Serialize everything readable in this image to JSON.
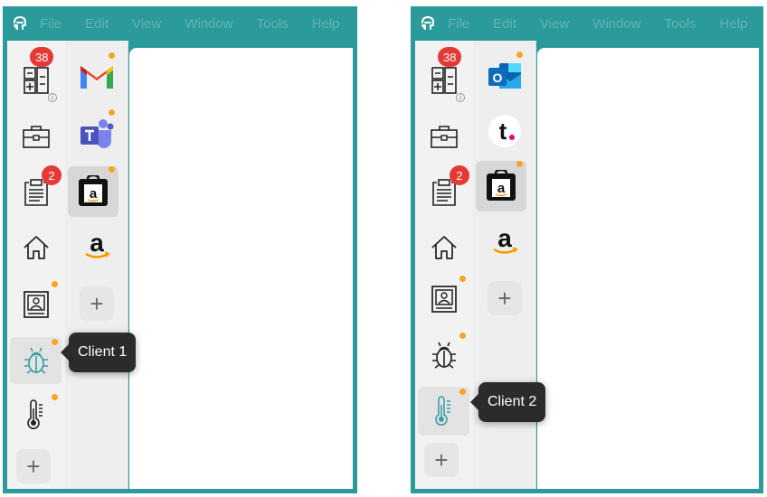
{
  "menu": [
    "File",
    "Edit",
    "View",
    "Window",
    "Tools",
    "Help"
  ],
  "colors": {
    "frame": "#2a9a9a",
    "badge": "#e53935",
    "dot": "#f5a623",
    "active_icon": "#3a9ea5"
  },
  "badges": {
    "calculator": "38",
    "clipboard": "2"
  },
  "workspaces": [
    {
      "name": "calculator",
      "icon": "calculator-icon"
    },
    {
      "name": "briefcase",
      "icon": "briefcase-icon"
    },
    {
      "name": "clipboard",
      "icon": "clipboard-icon"
    },
    {
      "name": "home",
      "icon": "home-icon"
    },
    {
      "name": "client-card",
      "icon": "id-card-icon"
    },
    {
      "name": "bug",
      "icon": "bug-icon"
    },
    {
      "name": "thermometer",
      "icon": "thermometer-icon"
    }
  ],
  "add_label": "+",
  "window1": {
    "apps": [
      {
        "name": "gmail",
        "icon": "gmail-icon",
        "letter": "M"
      },
      {
        "name": "teams",
        "icon": "teams-icon",
        "letter": "T"
      },
      {
        "name": "amazon-seller",
        "icon": "amazon-seller-icon",
        "letter": "a"
      },
      {
        "name": "amazon",
        "icon": "amazon-icon",
        "letter": "a"
      }
    ],
    "tooltip": "Client 1",
    "active_workspace": "bug"
  },
  "window2": {
    "apps": [
      {
        "name": "outlook",
        "icon": "outlook-icon",
        "letter": "O"
      },
      {
        "name": "tonic",
        "icon": "t-icon",
        "letter": "t"
      },
      {
        "name": "amazon-seller",
        "icon": "amazon-seller-icon",
        "letter": "a"
      },
      {
        "name": "amazon",
        "icon": "amazon-icon",
        "letter": "a"
      }
    ],
    "tooltip": "Client 2",
    "active_workspace": "thermometer"
  }
}
